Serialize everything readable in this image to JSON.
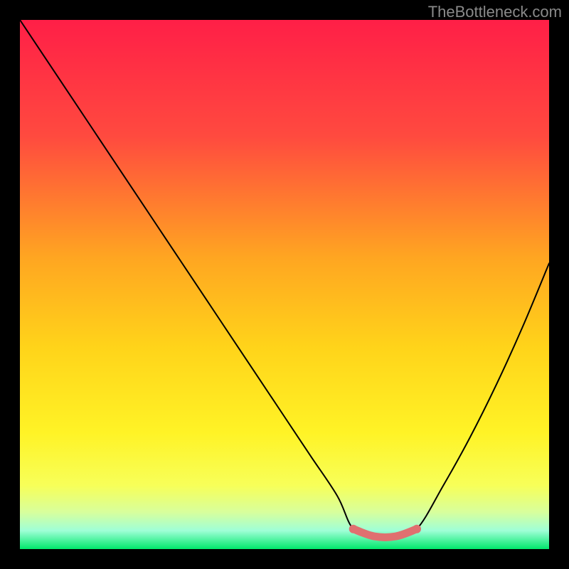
{
  "watermark": {
    "text": "TheBottleneck.com"
  },
  "chart_data": {
    "type": "line",
    "title": "",
    "xlabel": "",
    "ylabel": "",
    "xlim": [
      0,
      100
    ],
    "ylim": [
      0,
      100
    ],
    "series": [
      {
        "name": "bottleneck-curve",
        "x": [
          0,
          5,
          10,
          15,
          20,
          25,
          30,
          35,
          40,
          45,
          50,
          55,
          60,
          63,
          67,
          71,
          75,
          80,
          85,
          90,
          95,
          100
        ],
        "y": [
          100,
          92.5,
          85,
          77.5,
          70,
          62.5,
          55,
          47.5,
          40,
          32.5,
          25,
          17.5,
          10,
          3.8,
          2.4,
          2.4,
          3.8,
          12,
          21,
          31,
          42,
          54
        ]
      },
      {
        "name": "optimal-band",
        "x": [
          63,
          67,
          71,
          75
        ],
        "y": [
          3.8,
          2.4,
          2.4,
          3.8
        ]
      }
    ],
    "gradient_stops": [
      {
        "pct": 0,
        "color": "#ff1f47"
      },
      {
        "pct": 22,
        "color": "#ff4a3f"
      },
      {
        "pct": 45,
        "color": "#ffa621"
      },
      {
        "pct": 62,
        "color": "#ffd41a"
      },
      {
        "pct": 78,
        "color": "#fff326"
      },
      {
        "pct": 88,
        "color": "#f7ff59"
      },
      {
        "pct": 93,
        "color": "#d8ff9c"
      },
      {
        "pct": 96.5,
        "color": "#9fffd7"
      },
      {
        "pct": 100,
        "color": "#00e86b"
      }
    ],
    "band_color": "#e07070",
    "curve_color": "#000000"
  }
}
